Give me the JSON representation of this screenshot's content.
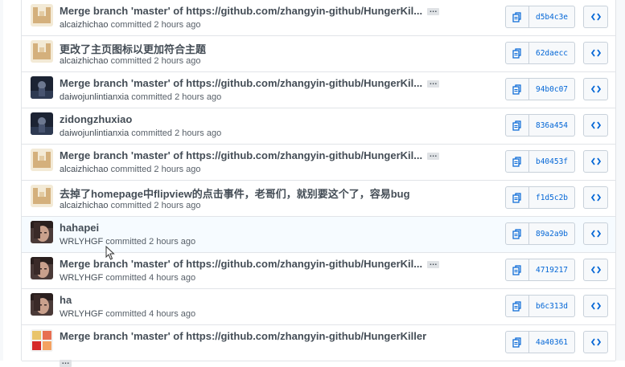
{
  "colors": {
    "link": "#0366d6",
    "border": "#e1e4e8",
    "hover_row": "#f6fbff"
  },
  "committed_word": "committed",
  "commits": [
    {
      "message": "Merge branch 'master' of https://github.com/zhangyin-github/HungerKil...",
      "has_ellipsis": true,
      "author": "alcaizhichao",
      "time": "2 hours ago",
      "sha": "d5b4c3e",
      "avatar": "tan"
    },
    {
      "message": "更改了主页图标以更加符合主题",
      "has_ellipsis": false,
      "author": "alcaizhichao",
      "time": "2 hours ago",
      "sha": "62daecc",
      "avatar": "tan"
    },
    {
      "message": "Merge branch 'master' of https://github.com/zhangyin-github/HungerKil...",
      "has_ellipsis": true,
      "author": "daiwojunlintianxia",
      "time": "2 hours ago",
      "sha": "94b0c07",
      "avatar": "dark"
    },
    {
      "message": "zidongzhuxiao",
      "has_ellipsis": false,
      "author": "daiwojunlintianxia",
      "time": "2 hours ago",
      "sha": "836a454",
      "avatar": "dark"
    },
    {
      "message": "Merge branch 'master' of https://github.com/zhangyin-github/HungerKil...",
      "has_ellipsis": true,
      "author": "alcaizhichao",
      "time": "2 hours ago",
      "sha": "b40453f",
      "avatar": "tan"
    },
    {
      "message": "去掉了homepage中flipview的点击事件，老哥们，就别要这个了，容易bug",
      "has_ellipsis": false,
      "author": "alcaizhichao",
      "time": "2 hours ago",
      "sha": "f1d5c2b",
      "avatar": "tan"
    },
    {
      "message": "hahapei",
      "has_ellipsis": false,
      "author": "WRLYHGF",
      "time": "2 hours ago",
      "sha": "89a2a9b",
      "avatar": "face",
      "hover": true
    },
    {
      "message": "Merge branch 'master' of https://github.com/zhangyin-github/HungerKil...",
      "has_ellipsis": true,
      "author": "WRLYHGF",
      "time": "4 hours ago",
      "sha": "4719217",
      "avatar": "face"
    },
    {
      "message": "ha",
      "has_ellipsis": false,
      "author": "WRLYHGF",
      "time": "4 hours ago",
      "sha": "b6c313d",
      "avatar": "face"
    },
    {
      "message": "Merge branch 'master' of https://github.com/zhangyin-github/HungerKiller",
      "has_ellipsis": true,
      "wrap": true,
      "author": "",
      "time": "",
      "sha": "4a40361",
      "avatar": "food"
    }
  ]
}
